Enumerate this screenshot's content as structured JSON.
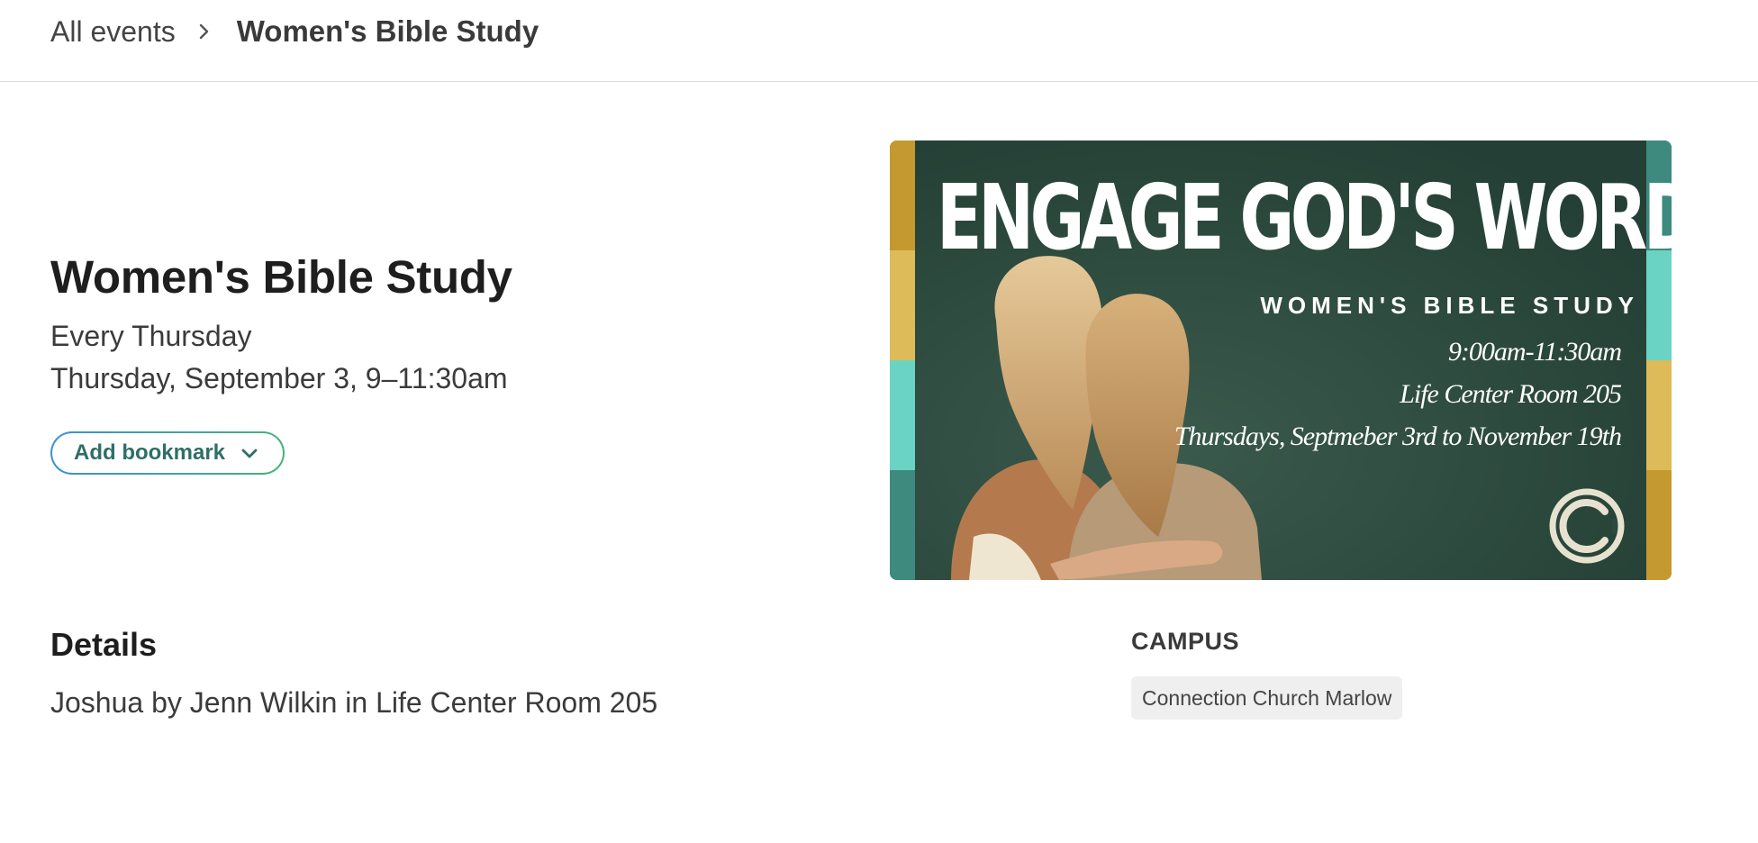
{
  "breadcrumb": {
    "all_events": "All events",
    "current": "Women's Bible Study"
  },
  "event": {
    "title": "Women's Bible Study",
    "recurrence": "Every Thursday",
    "datetime": "Thursday, September 3, 9–11:30am",
    "bookmark_label": "Add bookmark"
  },
  "banner": {
    "headline": "ENGAGE GOD'S WORD",
    "subheadline": "WOMEN'S BIBLE STUDY",
    "time": "9:00am-11:30am",
    "room": "Life Center Room 205",
    "schedule": "Thursdays, Septmeber 3rd to November 19th",
    "colors": {
      "background": "#2c4a3f",
      "stripes": [
        "#c49a30",
        "#dcbb58",
        "#6ad3c3",
        "#3e8a7f"
      ]
    }
  },
  "details": {
    "heading": "Details",
    "body": "Joshua by Jenn Wilkin in Life Center Room 205"
  },
  "campus": {
    "heading": "CAMPUS",
    "tag": "Connection Church Marlow"
  }
}
